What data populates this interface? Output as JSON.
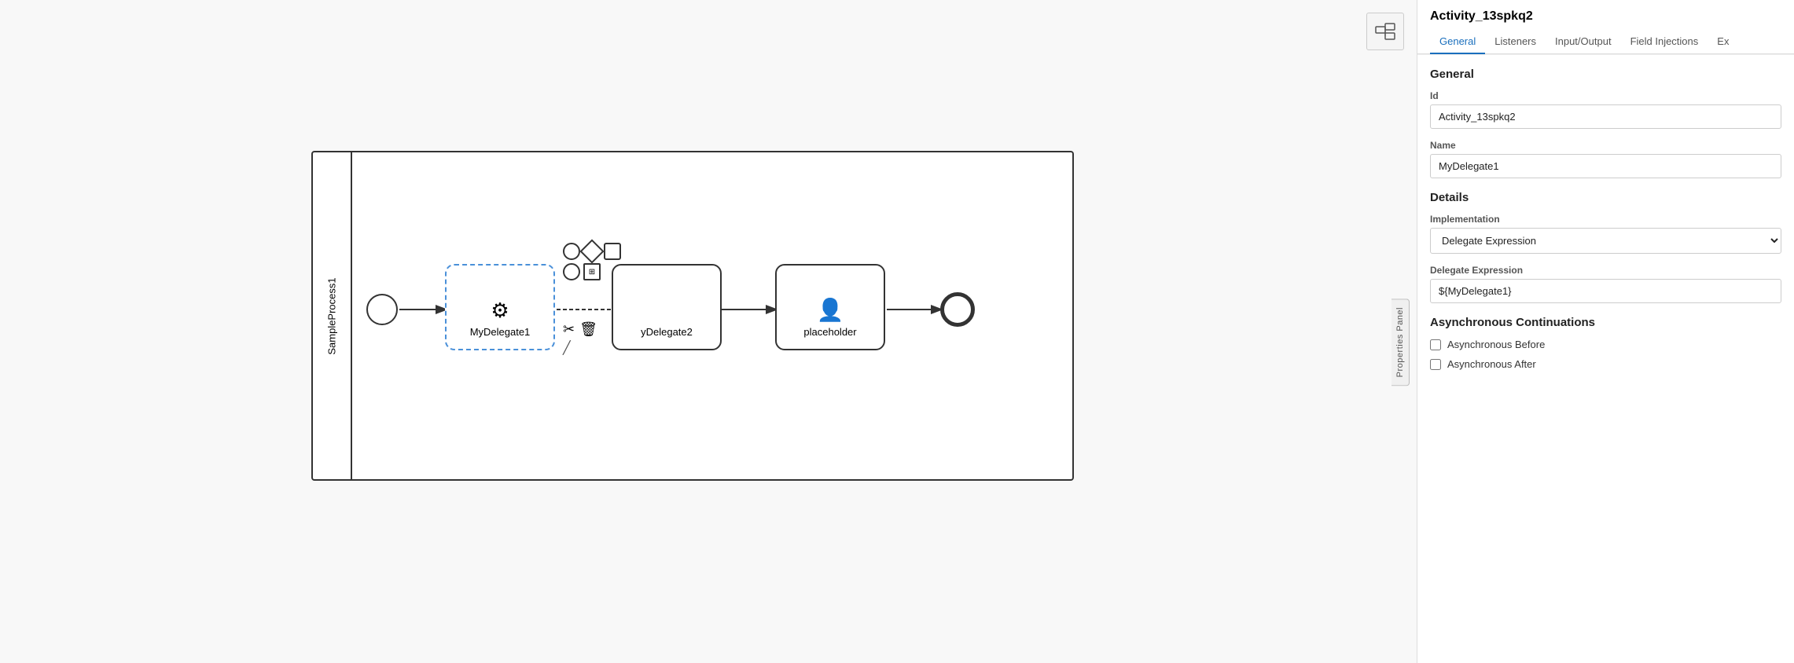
{
  "canvas": {
    "pool_label": "SampleProcess1",
    "start_event_label": "",
    "end_event_label": "",
    "task1": {
      "label": "MyDelegate1",
      "icon": "⚙",
      "selected": true
    },
    "task2": {
      "label": "yDelegate2",
      "icon": ""
    },
    "task3": {
      "label": "placeholder",
      "icon": "👤"
    },
    "context_menu": {
      "icons": [
        "○",
        "⬦",
        "□",
        "○",
        "⊡",
        "✂",
        "🗑",
        "╱"
      ]
    }
  },
  "minimap": {
    "label": "minimap-icon"
  },
  "properties_panel": {
    "side_label": "Properties Panel",
    "title": "Activity_13spkq2",
    "tabs": [
      {
        "label": "General",
        "active": true
      },
      {
        "label": "Listeners",
        "active": false
      },
      {
        "label": "Input/Output",
        "active": false
      },
      {
        "label": "Field Injections",
        "active": false
      },
      {
        "label": "Ex",
        "active": false
      }
    ],
    "general_section": {
      "title": "General",
      "id_label": "Id",
      "id_value": "Activity_13spkq2",
      "name_label": "Name",
      "name_value": "MyDelegate1"
    },
    "details_section": {
      "title": "Details",
      "implementation_label": "Implementation",
      "implementation_value": "Delegate Expression",
      "delegate_expression_label": "Delegate Expression",
      "delegate_expression_value": "${MyDelegate1}"
    },
    "async_section": {
      "title": "Asynchronous Continuations",
      "async_before_label": "Asynchronous Before",
      "async_after_label": "Asynchronous After"
    }
  }
}
